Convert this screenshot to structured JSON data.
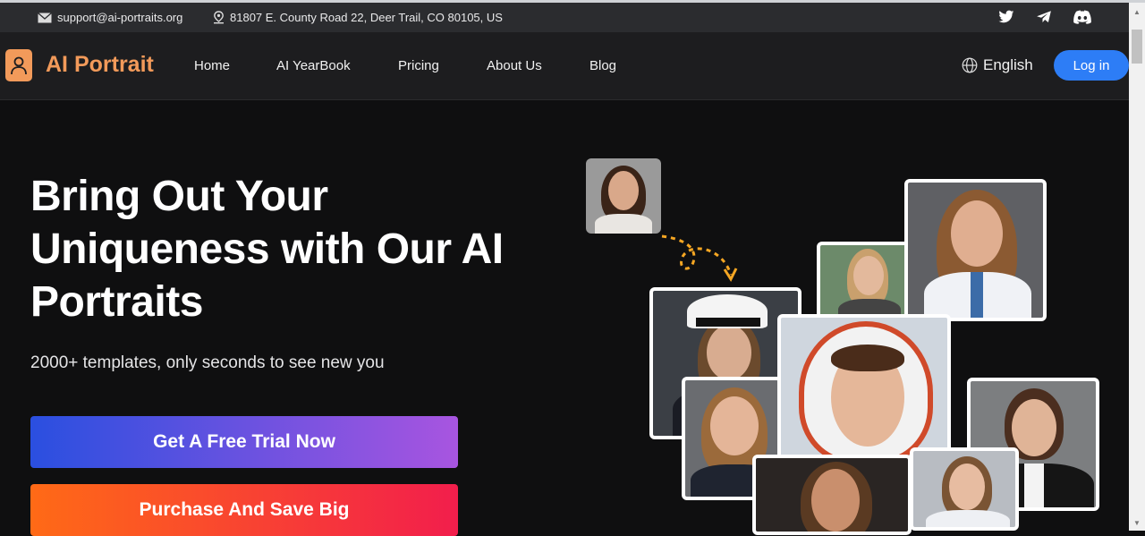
{
  "topbar": {
    "email": "support@ai-portraits.org",
    "address": "81807 E. County Road 22, Deer Trail, CO 80105, US",
    "social": [
      "twitter-icon",
      "telegram-icon",
      "discord-icon"
    ]
  },
  "nav": {
    "logo": "AI Portrait",
    "items": [
      "Home",
      "AI YearBook",
      "Pricing",
      "About Us",
      "Blog"
    ],
    "language": "English",
    "login": "Log in"
  },
  "hero": {
    "title_lines": [
      "Bring Out Your",
      "Uniqueness with Our AI",
      "Portraits"
    ],
    "subtitle": "2000+ templates, only seconds to see new you",
    "cta_trial": "Get A Free Trial Now",
    "cta_buy": "Purchase And Save Big"
  },
  "colors": {
    "brand": "#f29a5a",
    "login": "#2d7df6",
    "trial_gradient": [
      "#2a4fe0",
      "#a855e0"
    ],
    "buy_gradient": [
      "#ff6a16",
      "#f21e4c"
    ]
  }
}
